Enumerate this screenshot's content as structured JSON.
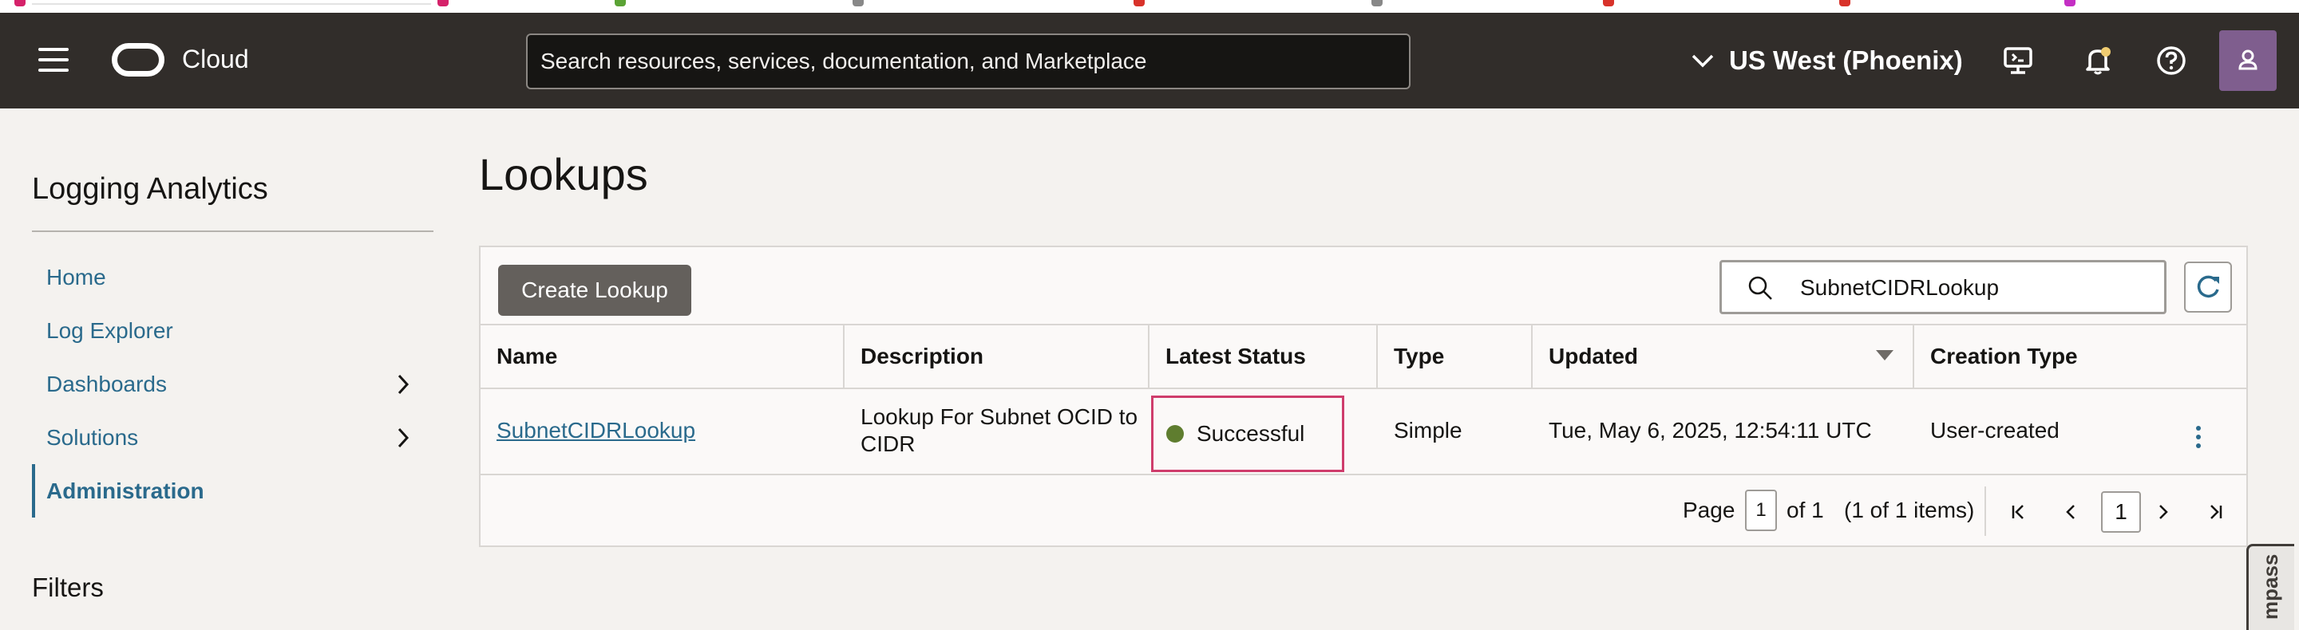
{
  "header": {
    "brand": "Cloud",
    "search_placeholder": "Search resources, services, documentation, and Marketplace",
    "region": "US West (Phoenix)"
  },
  "sidebar": {
    "title": "Logging Analytics",
    "items": [
      {
        "label": "Home"
      },
      {
        "label": "Log Explorer"
      },
      {
        "label": "Dashboards"
      },
      {
        "label": "Solutions"
      },
      {
        "label": "Administration"
      }
    ],
    "filters_title": "Filters"
  },
  "main": {
    "title": "Lookups",
    "create_button": "Create Lookup",
    "filter_value": "SubnetCIDRLookup",
    "columns": [
      "Name",
      "Description",
      "Latest Status",
      "Type",
      "Updated",
      "Creation Type"
    ],
    "rows": [
      {
        "name": "SubnetCIDRLookup",
        "description": "Lookup For Subnet OCID to CIDR",
        "status": "Successful",
        "type": "Simple",
        "updated": "Tue, May 6, 2025, 12:54:11 UTC",
        "creation_type": "User-created"
      }
    ],
    "pagination": {
      "page_label": "Page",
      "page_value": "1",
      "of_label": "of 1",
      "items_label": "(1 of 1 items)",
      "current_page": "1"
    }
  },
  "compass_label": "mpass",
  "colors": {
    "header_bg": "#312d2a",
    "link": "#2a6a8c",
    "status_success": "#5f7d2f",
    "highlight_border": "#cf3d6c"
  }
}
